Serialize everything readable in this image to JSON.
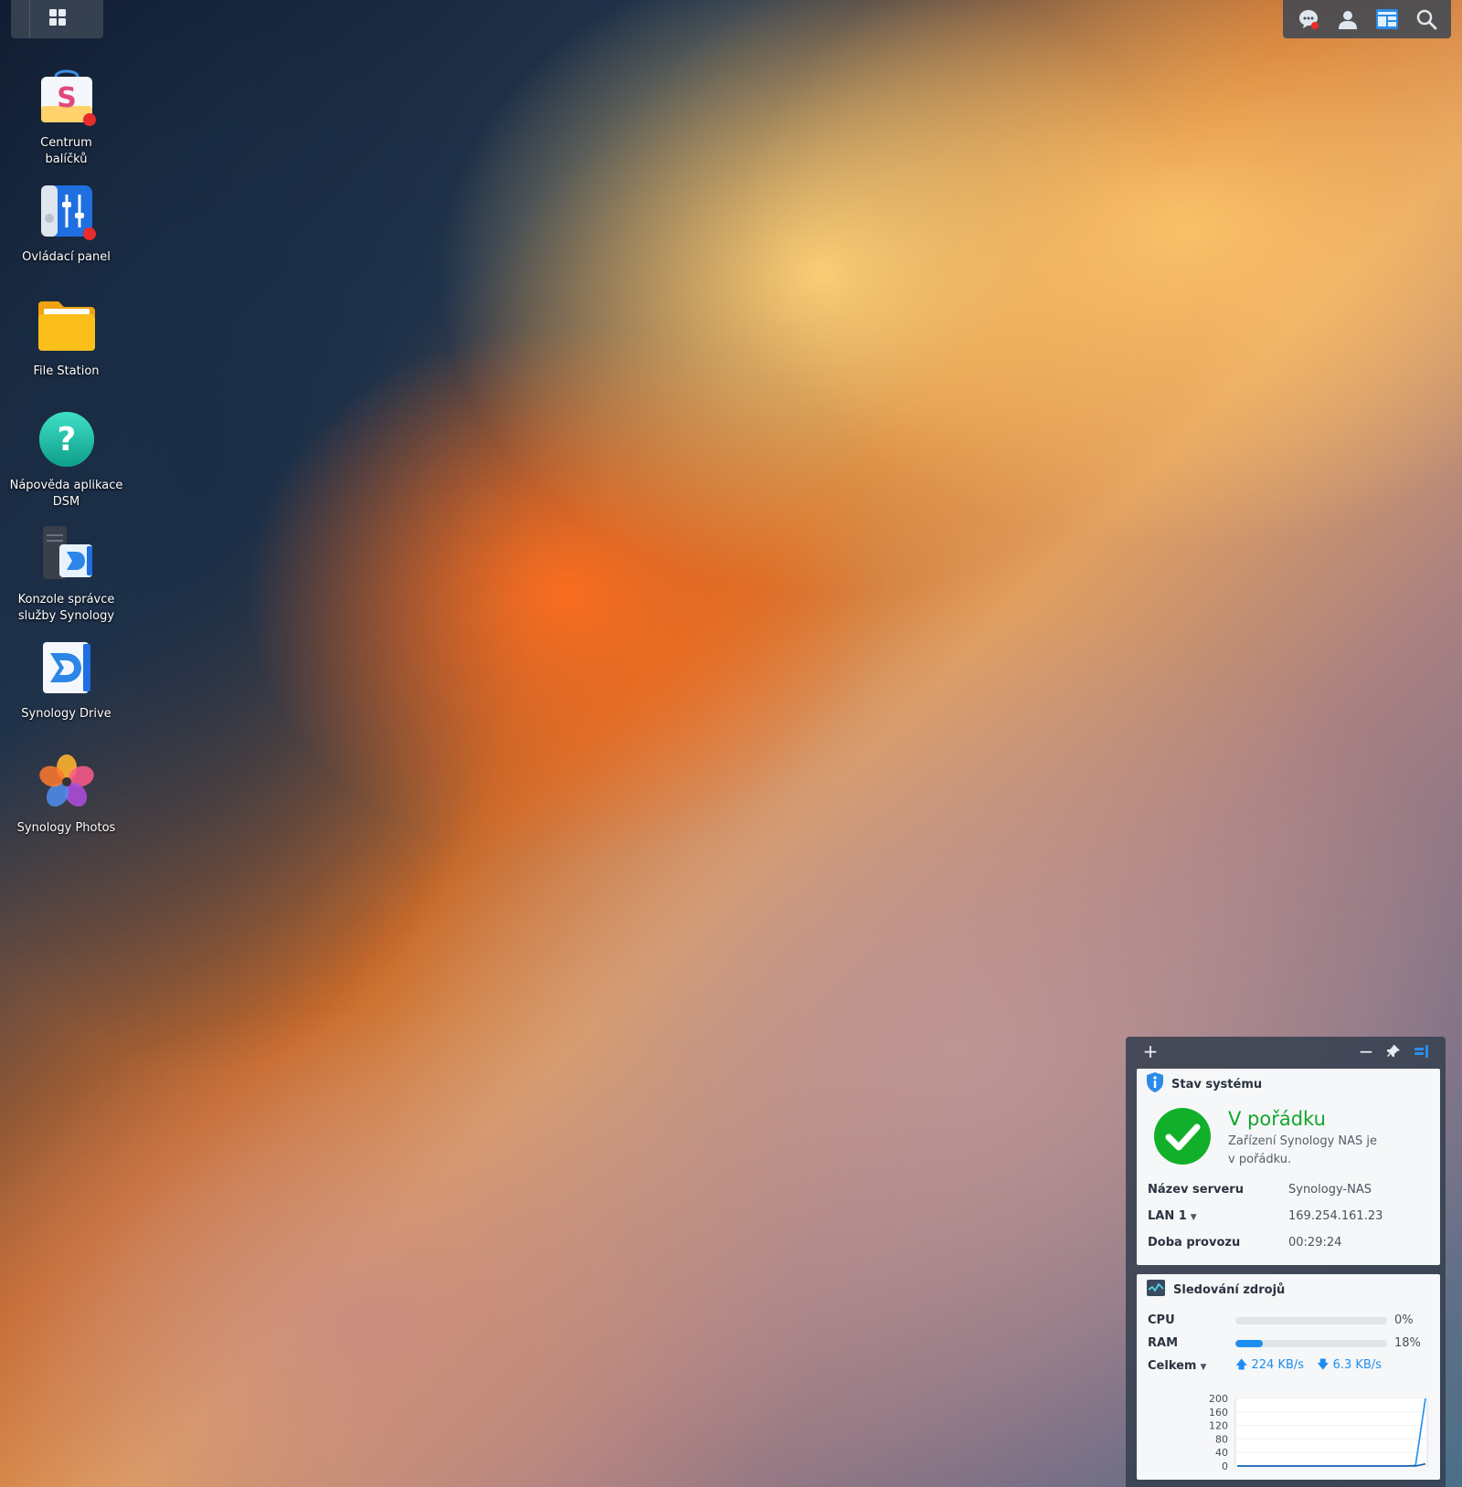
{
  "topbar": {
    "launcher_icon": "grid-icon",
    "right_icons": [
      "notifications-icon",
      "user-icon",
      "widgets-icon",
      "search-icon"
    ]
  },
  "desktop": {
    "icons": [
      {
        "label": "Centrum\nbalíčků",
        "icon": "package-center-icon",
        "badge": true
      },
      {
        "label": "Ovládací panel",
        "icon": "control-panel-icon",
        "badge": true
      },
      {
        "label": "File Station",
        "icon": "folder-icon",
        "badge": false
      },
      {
        "label": "Nápověda aplikace\nDSM",
        "icon": "help-icon",
        "badge": false
      },
      {
        "label": "Konzole správce\nslužby Synology",
        "icon": "drive-admin-console-icon",
        "badge": false
      },
      {
        "label": "Synology Drive",
        "icon": "synology-drive-icon",
        "badge": false
      },
      {
        "label": "Synology Photos",
        "icon": "synology-photos-icon",
        "badge": false
      }
    ]
  },
  "widget": {
    "toolbar": {
      "add": "+",
      "minimize": "−"
    },
    "system_status": {
      "title": "Stav systému",
      "status": "V pořádku",
      "description": "Zařízení Synology NAS je v pořádku.",
      "rows": [
        {
          "key": "Název serveru",
          "value": "Synology-NAS"
        },
        {
          "key": "LAN 1",
          "value": "169.254.161.23"
        },
        {
          "key": "Doba provozu",
          "value": "00:29:24"
        }
      ]
    },
    "resource_monitor": {
      "title": "Sledování zdrojů",
      "cpu_label": "CPU",
      "cpu_pct": 0,
      "cpu_text": "0%",
      "ram_label": "RAM",
      "ram_pct": 18,
      "ram_text": "18%",
      "total_label": "Celkem",
      "upload": "224 KB/s",
      "download": "6.3 KB/s"
    }
  },
  "chart_data": {
    "type": "line",
    "y_ticks": [
      "200",
      "160",
      "120",
      "80",
      "40",
      "0"
    ],
    "ylim": [
      0,
      200
    ],
    "series": [
      {
        "values": [
          0,
          0,
          0,
          0,
          0,
          0,
          0,
          0,
          0,
          0,
          0,
          0,
          0,
          0,
          0,
          0,
          0,
          0,
          2,
          224
        ]
      },
      {
        "values": [
          0,
          0,
          0,
          0,
          0,
          0,
          0,
          0,
          0,
          0,
          0,
          0,
          0,
          0,
          0,
          0,
          0,
          0,
          0,
          6.3
        ]
      }
    ],
    "colors": {
      "upload": "#1d8ef0",
      "download": "#0e5aa8"
    }
  }
}
